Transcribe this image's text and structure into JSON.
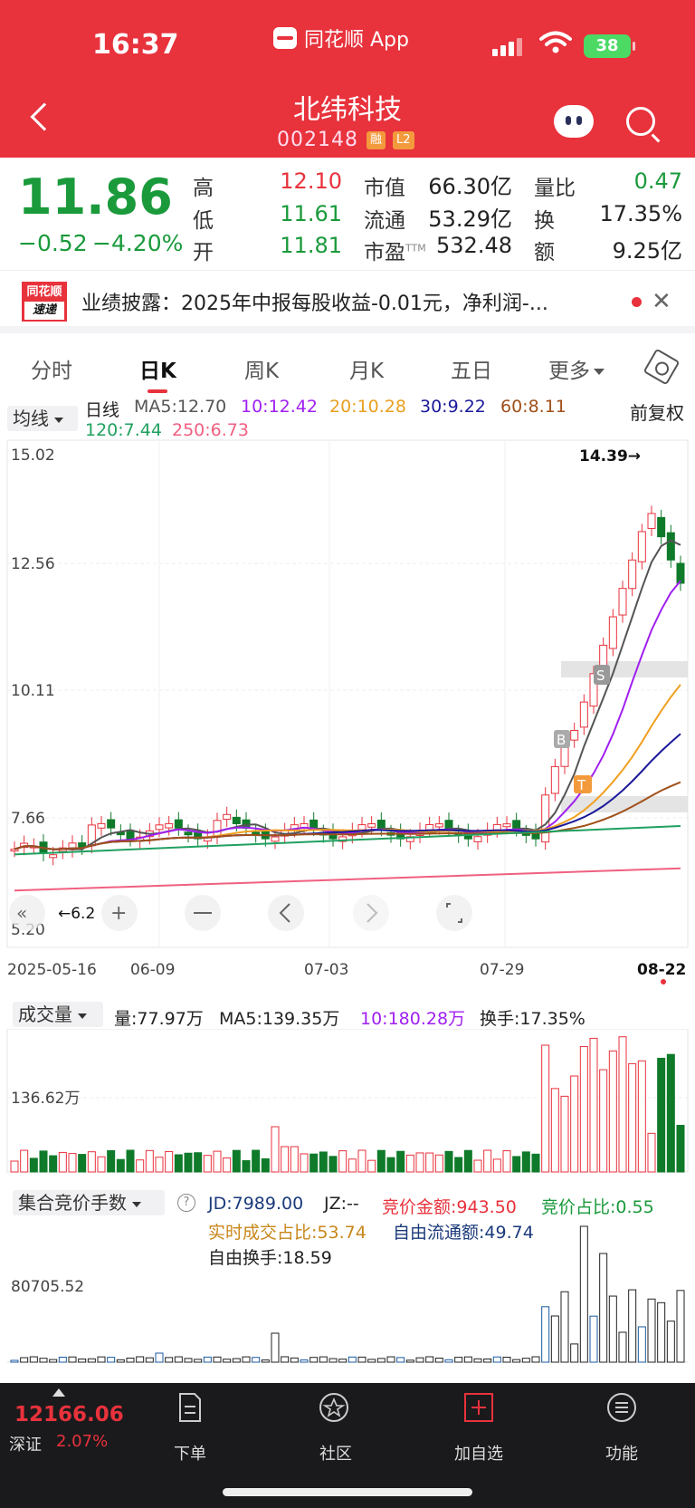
{
  "status_bar": {
    "time": "16:37",
    "battery": "38"
  },
  "header": {
    "app_name": "同花顺 App",
    "stock_name": "北纬科技",
    "stock_code": "002148",
    "badge_margin": "融",
    "badge_level": "L2"
  },
  "quote": {
    "price": "11.86",
    "change": "−0.52",
    "change_pct": "−4.20%",
    "high_label": "高",
    "high": "12.10",
    "low_label": "低",
    "low": "11.61",
    "open_label": "开",
    "open": "11.81",
    "mktcap_label": "市值",
    "mktcap": "66.30亿",
    "float_label": "流通",
    "float": "53.29亿",
    "pe_label": "市盈",
    "pe_sup": "TTM",
    "pe": "532.48",
    "volratio_label": "量比",
    "volratio": "0.47",
    "turnover_label": "换",
    "turnover": "17.35%",
    "amount_label": "额",
    "amount": "9.25亿"
  },
  "news": {
    "logo_top": "同花顺",
    "logo_bottom": "速递",
    "text": "业绩披露：2025年中报每股收益-0.01元，净利润-..."
  },
  "tabs": [
    "分时",
    "日K",
    "周K",
    "月K",
    "五日",
    "更多"
  ],
  "kline": {
    "indicator_select": "均线",
    "period": "日线",
    "ma5": "MA5:12.70",
    "ma10": "10:12.42",
    "ma20": "20:10.28",
    "ma30": "30:9.22",
    "ma60": "60:8.11",
    "ma120": "120:7.44",
    "ma250": "250:6.73",
    "adjust": "前复权",
    "y_ticks": [
      "15.02",
      "12.56",
      "10.11",
      "7.66",
      "5.20"
    ],
    "x_ticks": [
      "2025-05-16",
      "06-09",
      "07-03",
      "07-29",
      "08-22"
    ],
    "high_mark": "14.39→",
    "low_mark": "←6.2",
    "marker_b": "B",
    "marker_s": "S",
    "marker_t": "T",
    "colors": {
      "ma5": "#555555",
      "ma10": "#a020f0",
      "ma20": "#f0a020",
      "ma30": "#1a1a9a",
      "ma60": "#a0501a",
      "ma120": "#20a060",
      "ma250": "#f06080",
      "up": "#e8323c",
      "down": "#0f7a2a"
    }
  },
  "volume": {
    "select": "成交量",
    "vol": "量:77.97万",
    "ma5": "MA5:139.35万",
    "ma10": "10:180.28万",
    "turnover": "换手:17.35%",
    "y_tick": "136.62万"
  },
  "auction": {
    "select": "集合竞价手数",
    "jd": "JD:7989.00",
    "jz": "JZ:--",
    "amount": "竞价金额:943.50",
    "ratio": "竞价占比:0.55",
    "deal_ratio": "实时成交占比:53.74",
    "free_float": "自由流通额:49.74",
    "free_turnover": "自由换手:18.59",
    "y_tick": "80705.52"
  },
  "bottom": {
    "index_value": "12166.06",
    "index_name": "深证",
    "index_pct": "2.07%",
    "order": "下单",
    "community": "社区",
    "watch": "加自选",
    "function": "功能"
  }
}
